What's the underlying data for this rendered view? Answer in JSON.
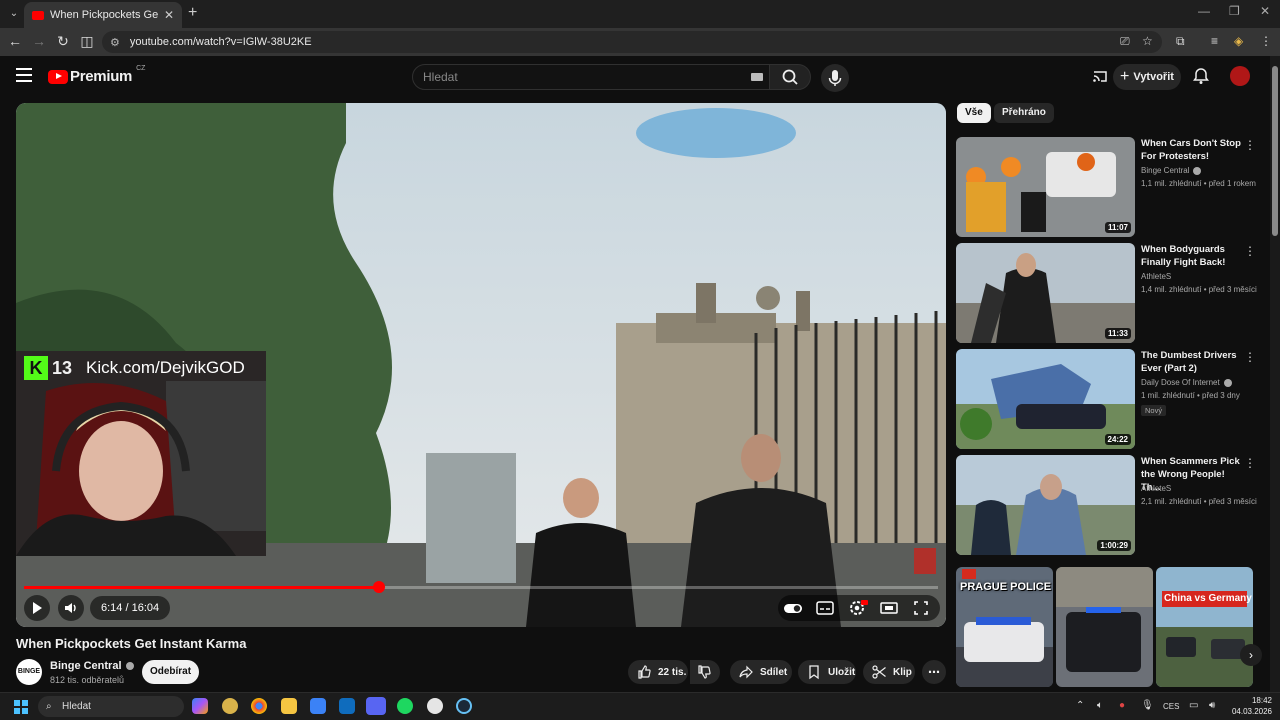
{
  "browser": {
    "tab_title": "When Pickpockets Get Instant Karma",
    "url": "youtube.com/watch?v=IGlW-38U2KE"
  },
  "youtube": {
    "logo_text": "Premium",
    "country": "CZ",
    "search_placeholder": "Hledat",
    "create_label": "Vytvořit"
  },
  "video": {
    "title": "When Pickpockets Get Instant Karma",
    "time": "6:14 / 16:04",
    "progress": 0.388,
    "overlay_number": "13",
    "overlay_url": "Kick.com/DejvikGOD",
    "overlay_k": "K"
  },
  "channel": {
    "avatar_text": "BINGE",
    "name": "Binge Central",
    "subs": "812 tis. odběratelů",
    "subscribe": "Odebírat"
  },
  "actions": {
    "likes": "22 tis.",
    "share": "Sdílet",
    "save": "Uložit",
    "clip": "Klip"
  },
  "chips": [
    "Vše",
    "Přehráno"
  ],
  "recommendations": [
    {
      "title": "When Cars Don't Stop For Protesters!",
      "channel": "Binge Central",
      "meta": "1,1 mil. zhlédnutí • před 1 rokem",
      "duration": "11:07",
      "verified": true
    },
    {
      "title": "When Bodyguards Finally Fight Back!",
      "channel": "AthleteS",
      "meta": "1,4 mil. zhlédnutí • před 3 měsíci",
      "duration": "11:33",
      "verified": false
    },
    {
      "title": "The Dumbest Drivers Ever (Part 2)",
      "channel": "Daily Dose Of Internet",
      "meta": "1 mil. zhlédnutí • před 3 dny",
      "duration": "24:22",
      "verified": true,
      "badge": "Nový"
    },
    {
      "title": "When Scammers Pick the Wrong People! Th...",
      "channel": "AthleteS",
      "meta": "2,1 mil. zhlédnutí • před 3 měsíci",
      "duration": "1:00:29",
      "verified": false
    }
  ],
  "shelf": [
    {
      "caption": "PRAGUE POLICE"
    },
    {
      "caption": ""
    },
    {
      "caption": "China vs Germany"
    }
  ],
  "taskbar": {
    "search": "Hledat",
    "lang": "CES",
    "time": "18:42",
    "date": "04.03.2026"
  },
  "colors": {
    "accent": "#ff0000",
    "background": "#0f0f0f",
    "kick": "#53fc18"
  }
}
